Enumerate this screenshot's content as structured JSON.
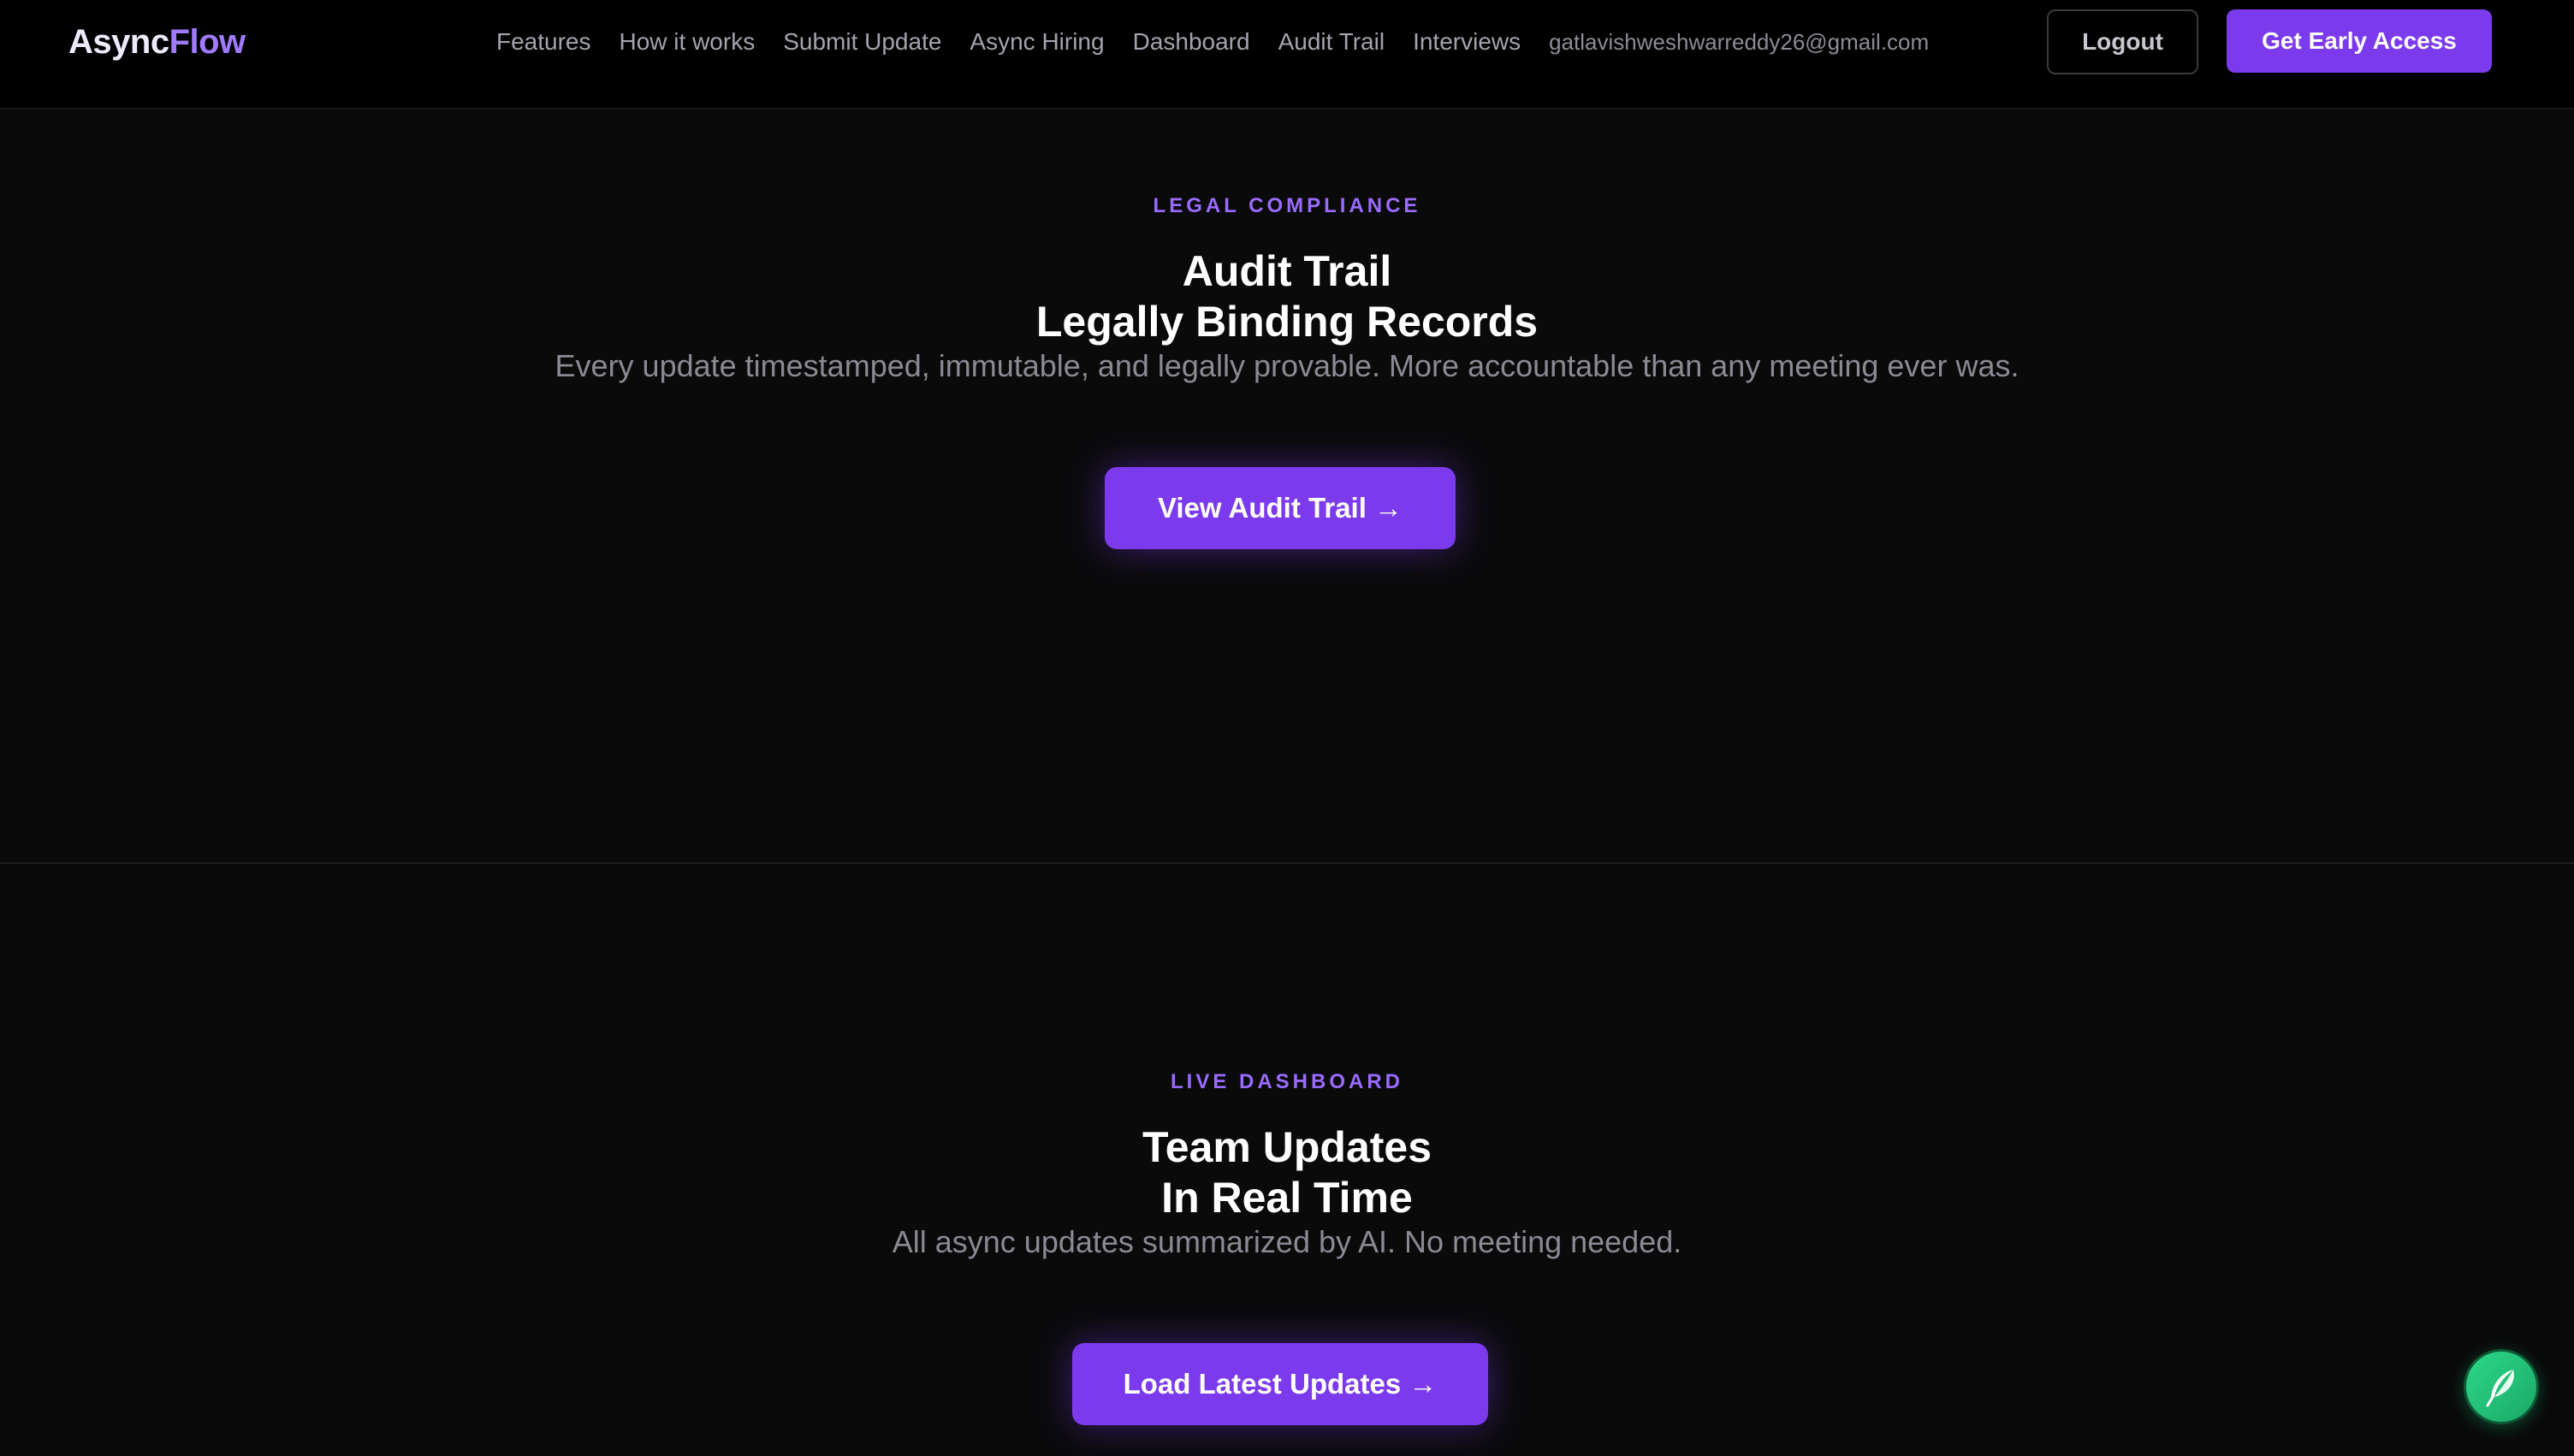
{
  "brand": {
    "name_part1": "Async",
    "name_part2": "Flow",
    "accent_color": "#7c3aed"
  },
  "nav": {
    "links": [
      {
        "label": "Features"
      },
      {
        "label": "How it works"
      },
      {
        "label": "Submit Update"
      },
      {
        "label": "Async Hiring"
      },
      {
        "label": "Dashboard"
      },
      {
        "label": "Audit Trail"
      },
      {
        "label": "Interviews"
      }
    ],
    "user_email": "gatlavishweshwarreddy26@gmail.com",
    "logout_label": "Logout",
    "early_access_label": "Get Early Access"
  },
  "audit_section": {
    "eyebrow": "LEGAL COMPLIANCE",
    "title_line1": "Audit Trail",
    "title_line2": "Legally Binding Records",
    "subtitle": "Every update timestamped, immutable, and legally provable. More accountable than any meeting ever was.",
    "cta_label": "View Audit Trail →"
  },
  "dashboard_section": {
    "eyebrow": "LIVE DASHBOARD",
    "title_line1": "Team Updates",
    "title_line2": "In Real Time",
    "subtitle": "All async updates summarized by AI. No meeting needed.",
    "cta_label": "Load Latest Updates →"
  },
  "floating_button": {
    "icon": "feather-icon",
    "color": "#22c57a"
  }
}
